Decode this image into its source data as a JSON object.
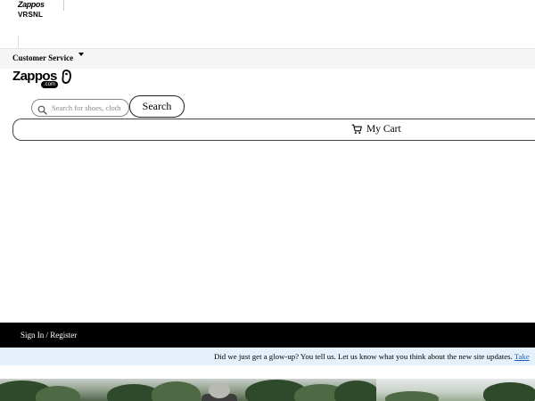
{
  "top_bar": {
    "zappos_logo_text": "Zappos",
    "vrsnl_logo_text": "VRSNL"
  },
  "utility_nav": {
    "customer_service_label": "Customer Service",
    "customer_service_icon": "caret-down-icon"
  },
  "header": {
    "logo_text": "Zappos",
    "logo_suffix": ".com",
    "logo_icon": "shoe-icon",
    "search": {
      "placeholder": "Search for shoes, cloth",
      "icon": "search-icon",
      "button_label": "Search"
    },
    "cart": {
      "label": "My Cart",
      "icon": "cart-icon"
    }
  },
  "account_bar": {
    "sign_in_label": "Sign In / Register"
  },
  "feedback_banner": {
    "message": "Did we just get a glow-up? You tell us. Let us know what you think about the new site updates. ",
    "link_label": "Take"
  },
  "colors": {
    "utility_nav_bg": "#f5f5f5",
    "account_bar_bg": "#000000",
    "feedback_banner_bg": "#e6f0fa",
    "link": "#1f5fbf"
  }
}
